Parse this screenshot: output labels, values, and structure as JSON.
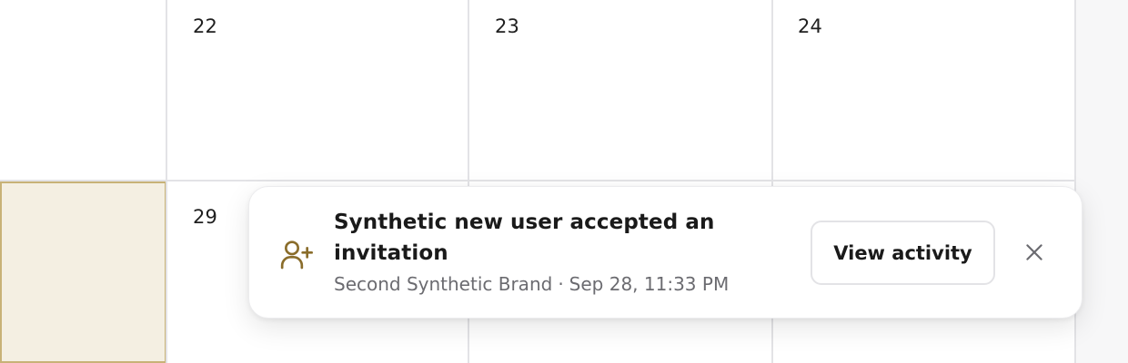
{
  "calendar": {
    "days": {
      "d22": "22",
      "d23": "23",
      "d24": "24",
      "d29": "29"
    }
  },
  "toast": {
    "icon": "user-plus-icon",
    "title": "Synthetic new user accepted an invitation",
    "brand": "Second Synthetic Brand",
    "separator": "·",
    "timestamp": "Sep 28, 11:33 PM",
    "action_label": "View activity",
    "close_icon": "close-icon"
  },
  "colors": {
    "accent": "#8a6d2b",
    "highlight_cell": "#f4efe2",
    "highlight_border": "#c8b277",
    "grid": "#e3e3e6",
    "muted_text": "#6b6b70"
  }
}
